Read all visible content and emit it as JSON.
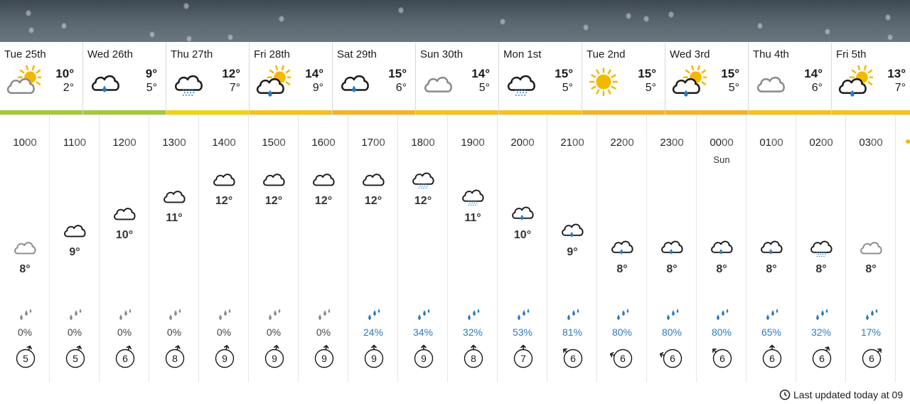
{
  "days": [
    {
      "name": "Tue",
      "date": "25th",
      "high": "10°",
      "low": "2°",
      "icon": "sun-cloud-icon",
      "band": "#a4c93a"
    },
    {
      "name": "Wed",
      "date": "26th",
      "high": "9°",
      "low": "5°",
      "icon": "rain-cloud-icon",
      "band": "#a4c93a"
    },
    {
      "name": "Thu",
      "date": "27th",
      "high": "12°",
      "low": "7°",
      "icon": "drizzle-cloud-icon",
      "band": "#f1d20f"
    },
    {
      "name": "Fri",
      "date": "28th",
      "high": "14°",
      "low": "9°",
      "icon": "sun-rain-cloud-icon",
      "band": "#f7c11a"
    },
    {
      "name": "Sat",
      "date": "29th",
      "high": "15°",
      "low": "6°",
      "icon": "rain-cloud-icon",
      "band": "#f5b324"
    },
    {
      "name": "Sun",
      "date": "30th",
      "high": "14°",
      "low": "5°",
      "icon": "grey-cloud-icon",
      "band": "#f7c11a"
    },
    {
      "name": "Mon",
      "date": "1st",
      "high": "15°",
      "low": "5°",
      "icon": "drizzle-cloud-icon",
      "band": "#f7c11a"
    },
    {
      "name": "Tue",
      "date": "2nd",
      "high": "15°",
      "low": "5°",
      "icon": "sun-icon",
      "band": "#f5b324"
    },
    {
      "name": "Wed",
      "date": "3rd",
      "high": "15°",
      "low": "5°",
      "icon": "sun-rain-cloud-icon",
      "band": "#f5b324"
    },
    {
      "name": "Thu",
      "date": "4th",
      "high": "14°",
      "low": "6°",
      "icon": "grey-cloud-icon",
      "band": "#f7c11a"
    },
    {
      "name": "Fri",
      "date": "5th",
      "high": "13°",
      "low": "7°",
      "icon": "sun-rain-cloud-icon",
      "band": "#f7c11a"
    }
  ],
  "hours": [
    {
      "hh": "10",
      "mm": "00",
      "sub": "",
      "icon": "grey-cloud-icon",
      "temp": "8°",
      "temp_c": 8,
      "rain": "0%",
      "wind": 5,
      "dir": 20
    },
    {
      "hh": "11",
      "mm": "00",
      "sub": "",
      "icon": "cloud-icon",
      "temp": "9°",
      "temp_c": 9,
      "rain": "0%",
      "wind": 5,
      "dir": 20
    },
    {
      "hh": "12",
      "mm": "00",
      "sub": "",
      "icon": "cloud-icon",
      "temp": "10°",
      "temp_c": 10,
      "rain": "0%",
      "wind": 6,
      "dir": 20
    },
    {
      "hh": "13",
      "mm": "00",
      "sub": "",
      "icon": "cloud-icon",
      "temp": "11°",
      "temp_c": 11,
      "rain": "0%",
      "wind": 8,
      "dir": 15
    },
    {
      "hh": "14",
      "mm": "00",
      "sub": "",
      "icon": "cloud-icon",
      "temp": "12°",
      "temp_c": 12,
      "rain": "0%",
      "wind": 9,
      "dir": 10
    },
    {
      "hh": "15",
      "mm": "00",
      "sub": "",
      "icon": "cloud-icon",
      "temp": "12°",
      "temp_c": 12,
      "rain": "0%",
      "wind": 9,
      "dir": 10
    },
    {
      "hh": "16",
      "mm": "00",
      "sub": "",
      "icon": "cloud-icon",
      "temp": "12°",
      "temp_c": 12,
      "rain": "0%",
      "wind": 9,
      "dir": 10
    },
    {
      "hh": "17",
      "mm": "00",
      "sub": "",
      "icon": "cloud-icon",
      "temp": "12°",
      "temp_c": 12,
      "rain": "24%",
      "wind": 9,
      "dir": 0
    },
    {
      "hh": "18",
      "mm": "00",
      "sub": "",
      "icon": "drizzle-cloud-icon",
      "temp": "12°",
      "temp_c": 12,
      "rain": "34%",
      "wind": 9,
      "dir": 0
    },
    {
      "hh": "19",
      "mm": "00",
      "sub": "",
      "icon": "drizzle-cloud-icon",
      "temp": "11°",
      "temp_c": 11,
      "rain": "32%",
      "wind": 8,
      "dir": 0
    },
    {
      "hh": "20",
      "mm": "00",
      "sub": "",
      "icon": "rain-cloud-icon",
      "temp": "10°",
      "temp_c": 10,
      "rain": "53%",
      "wind": 7,
      "dir": 0
    },
    {
      "hh": "21",
      "mm": "00",
      "sub": "",
      "icon": "rain-cloud-icon",
      "temp": "9°",
      "temp_c": 9,
      "rain": "81%",
      "wind": 6,
      "dir": -45
    },
    {
      "hh": "22",
      "mm": "00",
      "sub": "",
      "icon": "rain-cloud-icon",
      "temp": "8°",
      "temp_c": 8,
      "rain": "80%",
      "wind": 6,
      "dir": -70
    },
    {
      "hh": "23",
      "mm": "00",
      "sub": "",
      "icon": "rain-cloud-icon",
      "temp": "8°",
      "temp_c": 8,
      "rain": "80%",
      "wind": 6,
      "dir": -70
    },
    {
      "hh": "00",
      "mm": "00",
      "sub": "Sun",
      "icon": "rain-cloud-icon",
      "temp": "8°",
      "temp_c": 8,
      "rain": "80%",
      "wind": 6,
      "dir": -45
    },
    {
      "hh": "01",
      "mm": "00",
      "sub": "",
      "icon": "rain-cloud-icon",
      "temp": "8°",
      "temp_c": 8,
      "rain": "65%",
      "wind": 6,
      "dir": 0
    },
    {
      "hh": "02",
      "mm": "00",
      "sub": "",
      "icon": "drizzle-cloud-icon",
      "temp": "8°",
      "temp_c": 8,
      "rain": "32%",
      "wind": 6,
      "dir": 30
    },
    {
      "hh": "03",
      "mm": "00",
      "sub": "",
      "icon": "grey-cloud-icon",
      "temp": "8°",
      "temp_c": 8,
      "rain": "17%",
      "wind": 6,
      "dir": 45
    }
  ],
  "footer": {
    "last_updated": "Last updated today at 09"
  },
  "colors": {
    "rain_wet": "#2b7bc0",
    "rain_dry": "#8a8a8a",
    "sun": "#f5b800"
  }
}
